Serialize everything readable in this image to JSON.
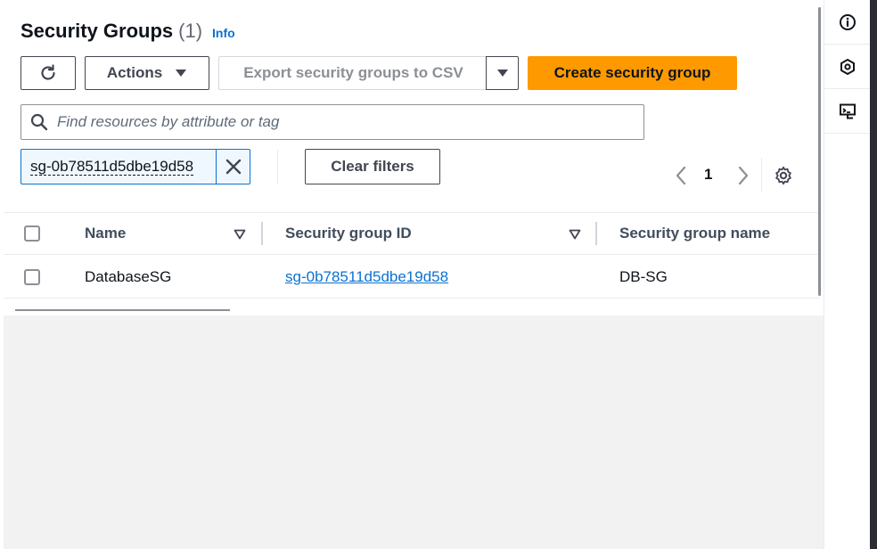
{
  "header": {
    "title": "Security Groups",
    "count": "(1)",
    "info_label": "Info"
  },
  "toolbar": {
    "actions_label": "Actions",
    "export_label": "Export security groups to CSV",
    "create_label": "Create security group"
  },
  "search": {
    "placeholder": "Find resources by attribute or tag"
  },
  "filters": {
    "token_value": "sg-0b78511d5dbe19d58",
    "clear_label": "Clear filters"
  },
  "pagination": {
    "current_page": "1"
  },
  "table": {
    "columns": [
      "Name",
      "Security group ID",
      "Security group name"
    ],
    "rows": [
      {
        "name": "DatabaseSG",
        "security_group_id": "sg-0b78511d5dbe19d58",
        "security_group_name": "DB-SG"
      }
    ]
  },
  "icons": {
    "refresh": "refresh-icon",
    "actions_caret": "caret-down-icon",
    "search": "search-icon",
    "close": "close-icon",
    "prev": "chevron-left-icon",
    "next": "chevron-right-icon",
    "settings": "gear-icon",
    "sort": "sort-down-icon",
    "rail": [
      "info-icon",
      "hexagon-icon",
      "cloudshell-icon"
    ]
  },
  "colors": {
    "primary": "#ff9900",
    "link": "#0972d3"
  }
}
